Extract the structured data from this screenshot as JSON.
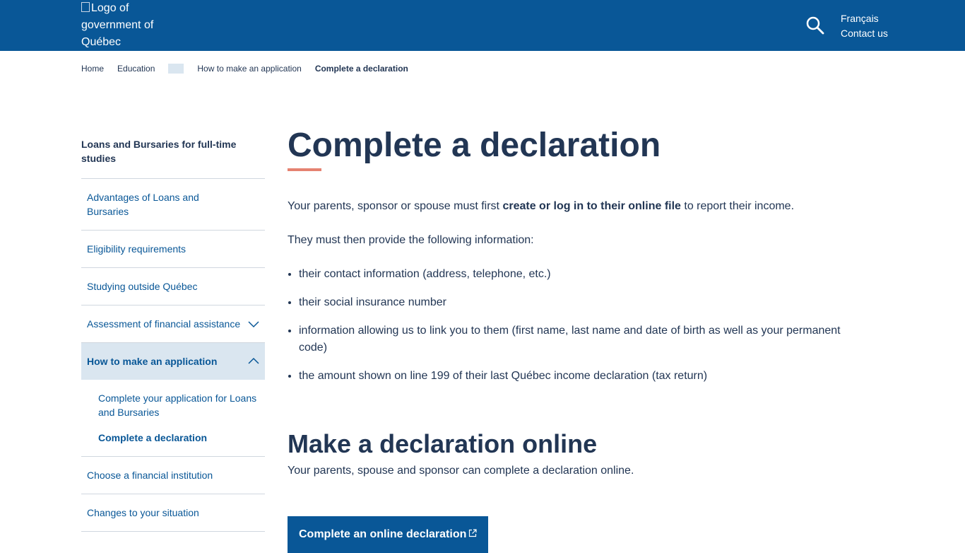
{
  "header": {
    "logo_alt": "Logo of government of Québec",
    "lang_link": "Français",
    "contact_link": "Contact us",
    "search_icon": "search-icon"
  },
  "breadcrumb": {
    "items": [
      "Home",
      "Education",
      "How to make an application"
    ],
    "current": "Complete a declaration"
  },
  "sidebar": {
    "title": "Loans and Bursaries for full-time studies",
    "items": [
      "Advantages of Loans and Bursaries",
      "Eligibility requirements",
      "Studying outside Québec",
      "Assessment of financial assistance",
      "How to make an application",
      "Choose a financial institution",
      "Changes to your situation"
    ],
    "subitems": [
      "Complete your application for Loans and Bursaries",
      "Complete a declaration"
    ]
  },
  "main": {
    "title": "Complete a declaration",
    "intro_before": "Your parents, sponsor or spouse must first ",
    "intro_bold": "create or log in to their online file",
    "intro_after": " to report their income.",
    "lead": "They must then provide the following information:",
    "list": [
      "their contact information (address, telephone, etc.)",
      "their social insurance number",
      "information allowing us to link you to them (first name, last name and date of birth as well as your permanent code)",
      "the amount shown on line 199 of their last Québec income declaration (tax return)"
    ],
    "section_title": "Make a declaration online",
    "section_text": "Your parents, spouse and sponsor can complete a declaration online.",
    "cta_label": "Complete an online declaration"
  },
  "colors": {
    "brand_blue": "#095797",
    "text_dark": "#223654",
    "accent_red": "#e58271",
    "active_bg": "#dae6f0"
  }
}
